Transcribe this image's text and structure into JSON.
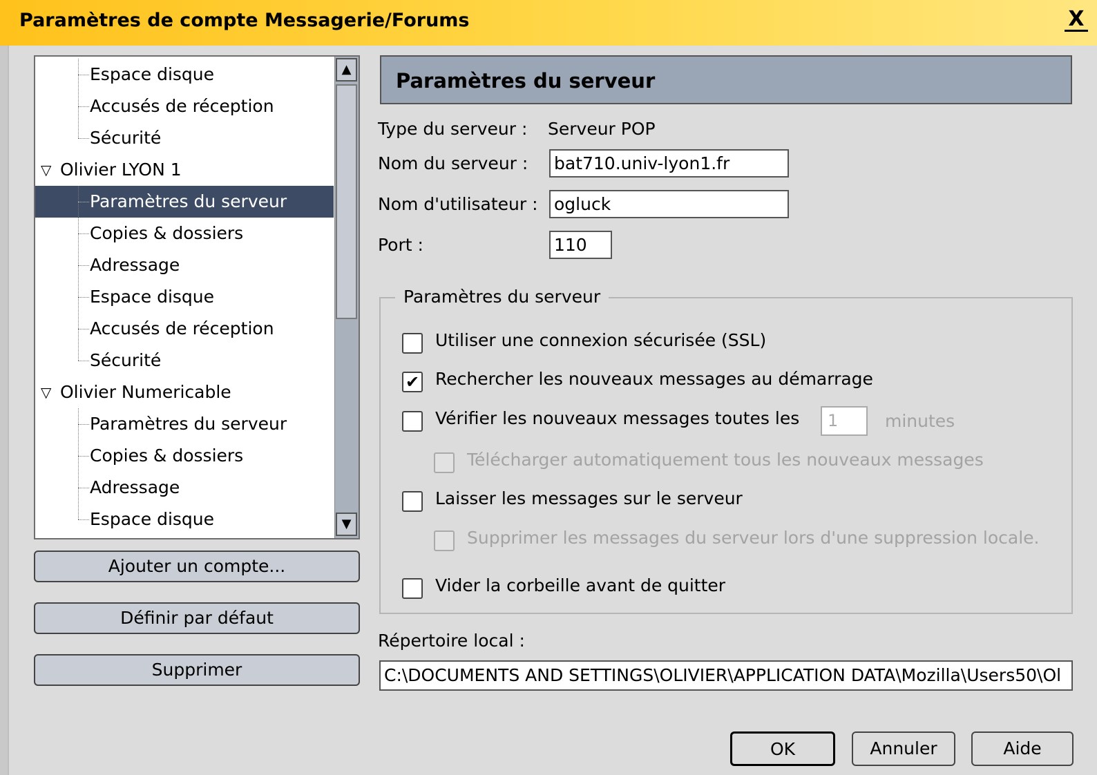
{
  "window": {
    "title": "Paramètres de compte Messagerie/Forums",
    "close_glyph": "X"
  },
  "tree": {
    "items": [
      {
        "label": "Espace disque",
        "level": "child"
      },
      {
        "label": "Accusés de réception",
        "level": "child"
      },
      {
        "label": "Sécurité",
        "level": "child"
      },
      {
        "label": "Olivier LYON 1",
        "level": "parent",
        "expanded": true
      },
      {
        "label": "Paramètres du serveur",
        "level": "child",
        "selected": true
      },
      {
        "label": "Copies & dossiers",
        "level": "child"
      },
      {
        "label": "Adressage",
        "level": "child"
      },
      {
        "label": "Espace disque",
        "level": "child"
      },
      {
        "label": "Accusés de réception",
        "level": "child"
      },
      {
        "label": "Sécurité",
        "level": "child"
      },
      {
        "label": "Olivier Numericable",
        "level": "parent",
        "expanded": true
      },
      {
        "label": "Paramètres du serveur",
        "level": "child"
      },
      {
        "label": "Copies & dossiers",
        "level": "child"
      },
      {
        "label": "Adressage",
        "level": "child"
      },
      {
        "label": "Espace disque",
        "level": "child"
      }
    ]
  },
  "left_buttons": {
    "add_account": "Ajouter un compte...",
    "set_default": "Définir par défaut",
    "delete": "Supprimer"
  },
  "panel": {
    "header": "Paramètres du serveur",
    "server_type_label": "Type du serveur :",
    "server_type_value": "Serveur POP",
    "server_name_label": "Nom du serveur :",
    "server_name_value": "bat710.univ-lyon1.fr",
    "username_label": "Nom d'utilisateur :",
    "username_value": "ogluck",
    "port_label": "Port  :",
    "port_value": "110",
    "group_title": "Paramètres du serveur",
    "options": {
      "ssl": {
        "label": "Utiliser une connexion sécurisée (SSL)",
        "checked": false
      },
      "check_startup": {
        "label": "Rechercher les nouveaux messages au démarrage",
        "checked": true
      },
      "check_every": {
        "label": "Vérifier les nouveaux messages toutes les",
        "checked": false
      },
      "check_every_value": "1",
      "check_every_unit": "minutes",
      "auto_download": {
        "label": "Télécharger automatiquement tous les nouveaux messages",
        "checked": false,
        "disabled": true
      },
      "leave_on_server": {
        "label": "Laisser les messages sur le serveur",
        "checked": false
      },
      "delete_on_local": {
        "label": "Supprimer les messages du serveur lors d'une suppression locale.",
        "checked": false,
        "disabled": true
      },
      "empty_trash": {
        "label": "Vider la corbeille avant de quitter",
        "checked": false
      }
    },
    "local_dir_label": "Répertoire local :",
    "local_dir_value": "C:\\DOCUMENTS AND SETTINGS\\OLIVIER\\APPLICATION DATA\\Mozilla\\Users50\\Ol"
  },
  "dialog_buttons": {
    "ok": "OK",
    "cancel": "Annuler",
    "help": "Aide"
  },
  "icons": {
    "expanded_triangle": "triangle-down-icon",
    "scroll_up": "arrow-up-icon",
    "scroll_down": "arrow-down-icon",
    "check": "checkmark-icon"
  },
  "colors": {
    "titlebar": "#ffc21c",
    "selection": "#3d4c64",
    "header": "#9aa5b5"
  }
}
